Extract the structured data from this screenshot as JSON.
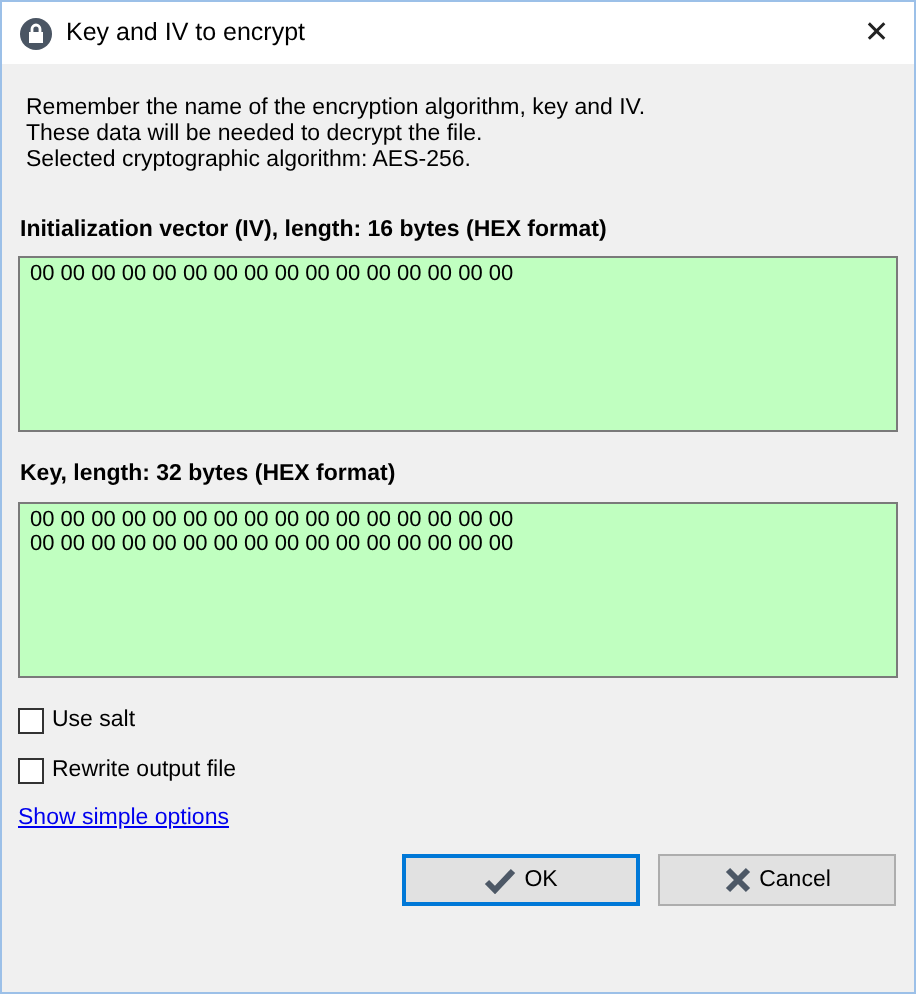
{
  "window": {
    "title": "Key and IV to encrypt",
    "close": "✕"
  },
  "info": [
    "Remember the name of the encryption algorithm, key and IV.",
    "These data will be needed to decrypt the file.",
    "Selected cryptographic algorithm: AES-256."
  ],
  "fields": [
    {
      "label": "Initialization vector (IV), length: 16 bytes (HEX format)",
      "value": "00 00 00 00 00 00 00 00 00 00 00 00 00 00 00 00"
    },
    {
      "label": "Key, length: 32 bytes (HEX format)",
      "value": "00 00 00 00 00 00 00 00 00 00 00 00 00 00 00 00\n00 00 00 00 00 00 00 00 00 00 00 00 00 00 00 00"
    }
  ],
  "options": [
    {
      "label": "Use salt",
      "checked": false
    },
    {
      "label": "Rewrite output file",
      "checked": false
    }
  ],
  "link": "Show simple options",
  "buttons": [
    {
      "label": "OK",
      "kind": "ok",
      "focused": true
    },
    {
      "label": "Cancel",
      "kind": "cancel",
      "focused": false
    }
  ]
}
